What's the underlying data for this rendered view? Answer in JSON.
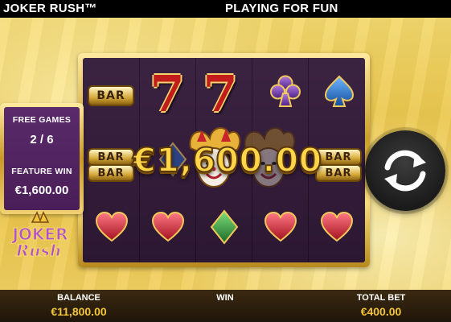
{
  "header": {
    "game_title": "JOKER RUSH™",
    "mode_label": "PLAYING FOR FUN"
  },
  "reels": {
    "top_row": [
      "BAR",
      "7",
      "7",
      "clubs",
      "spades"
    ],
    "middle_row": [
      "BAR BAR",
      "diamonds",
      "joker",
      "joker",
      "BAR BAR"
    ],
    "bottom_row": [
      "heart",
      "heart",
      "diamond",
      "heart",
      "heart"
    ],
    "bar_label": "BAR"
  },
  "win_banner": {
    "amount": "€1,600.00"
  },
  "side_panel": {
    "free_games_label": "FREE GAMES",
    "free_games_value": "2 / 6",
    "feature_win_label": "FEATURE WIN",
    "feature_win_value": "€1,600.00"
  },
  "logo": {
    "line1": "JOKER",
    "line2": "Rush"
  },
  "footer": {
    "balance_label": "BALANCE",
    "balance_value": "€11,800.00",
    "win_label": "WIN",
    "win_value": "",
    "total_bet_label": "TOTAL BET",
    "total_bet_value": "€400.00"
  },
  "colors": {
    "gold": "#f3c53a",
    "reel_bg": "#3b2342",
    "panel_bg": "#5a2a6a",
    "heart_red": "#d8263a",
    "card_purple": "#6b3fa0",
    "card_blue": "#1f6fd0",
    "diamond_green": "#3aa04a"
  },
  "icons": {
    "spin": "refresh-arrows-icon",
    "clubs": "club-suit-icon",
    "spades": "spade-suit-icon",
    "heart": "heart-suit-icon",
    "diamond": "diamond-suit-icon"
  }
}
